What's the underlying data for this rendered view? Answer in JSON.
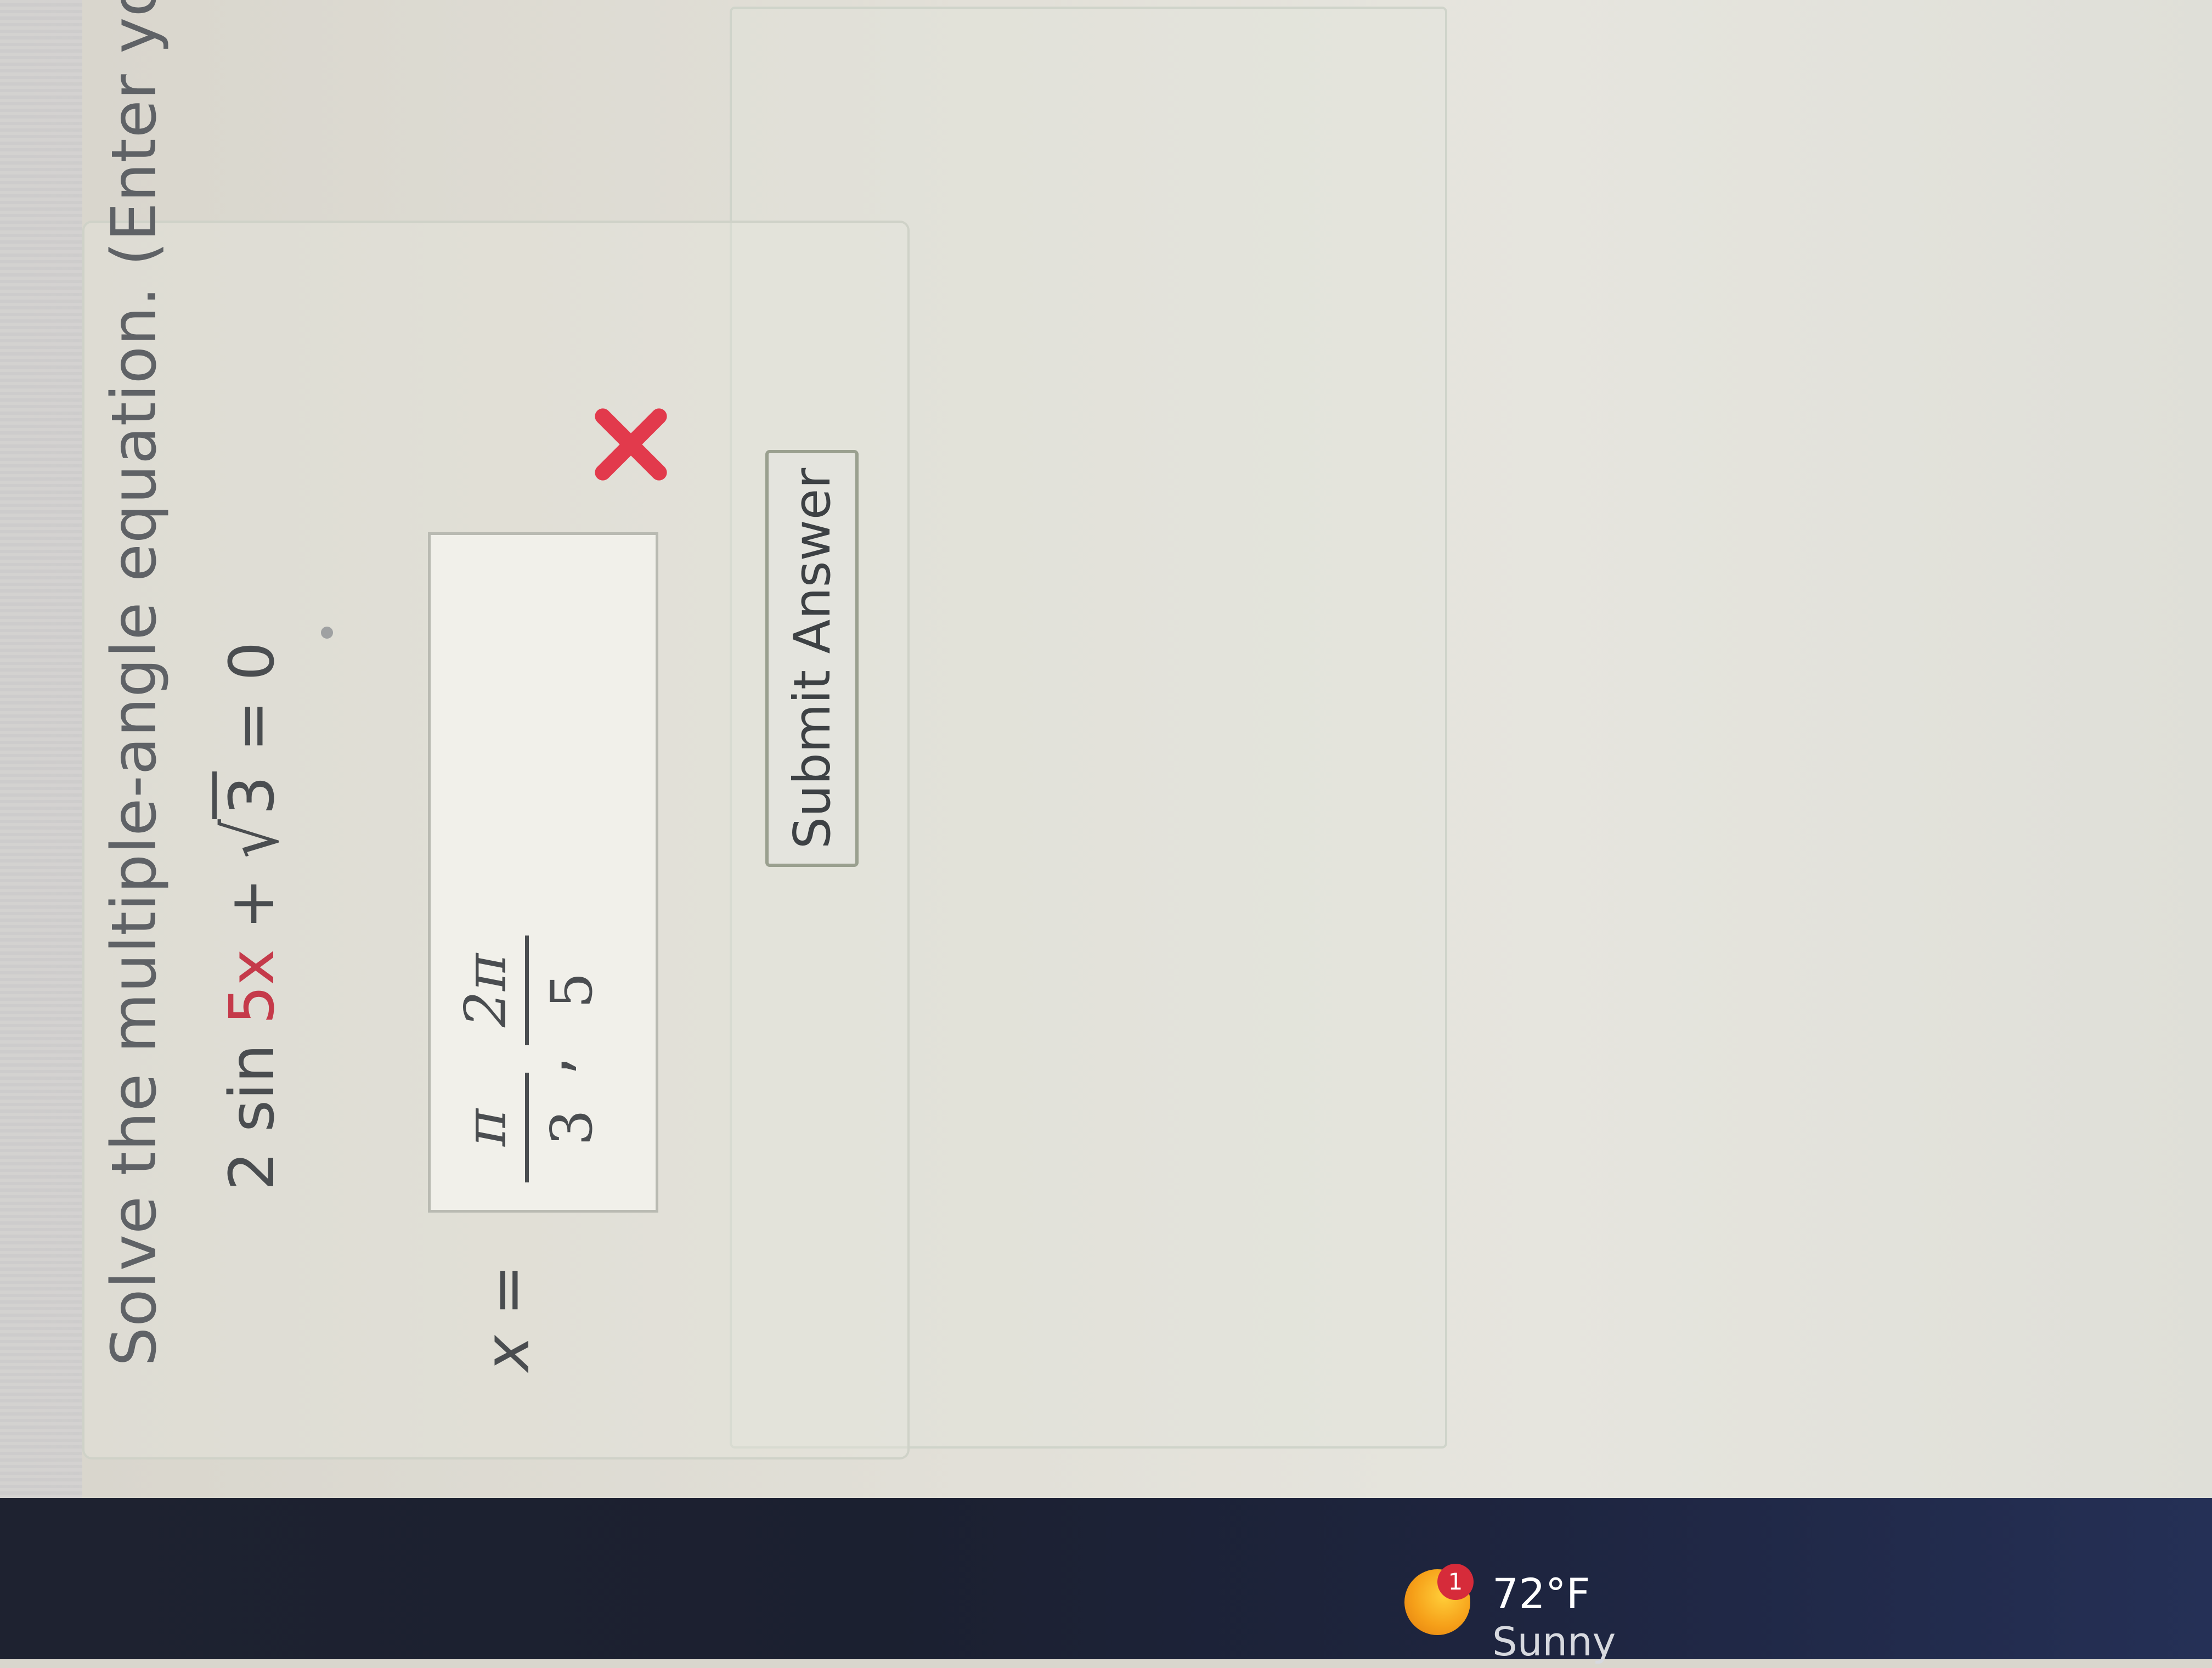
{
  "question": {
    "prompt": "Solve the multiple-angle equation. (Enter your",
    "equation": {
      "part_coeff": "2 sin ",
      "part_arg": "5x",
      "part_plus": " + ",
      "part_radicand": "3",
      "part_tail": " = 0"
    }
  },
  "answer": {
    "variable_label": "x =",
    "fraction_1": {
      "numerator": "π",
      "denominator": "3"
    },
    "separator": ",",
    "fraction_2": {
      "numerator": "2π",
      "denominator": "5"
    },
    "status_icon": "red-x-icon"
  },
  "buttons": {
    "submit_label": "Submit Answer"
  },
  "taskbar": {
    "weather": {
      "icon": "sun-icon",
      "badge_count": "1",
      "temperature": "72°F",
      "condition": "Sunny"
    }
  },
  "colors": {
    "highlight_red": "#c53a4a",
    "error_red": "#e23a4c",
    "taskbar": "#1e2230"
  }
}
